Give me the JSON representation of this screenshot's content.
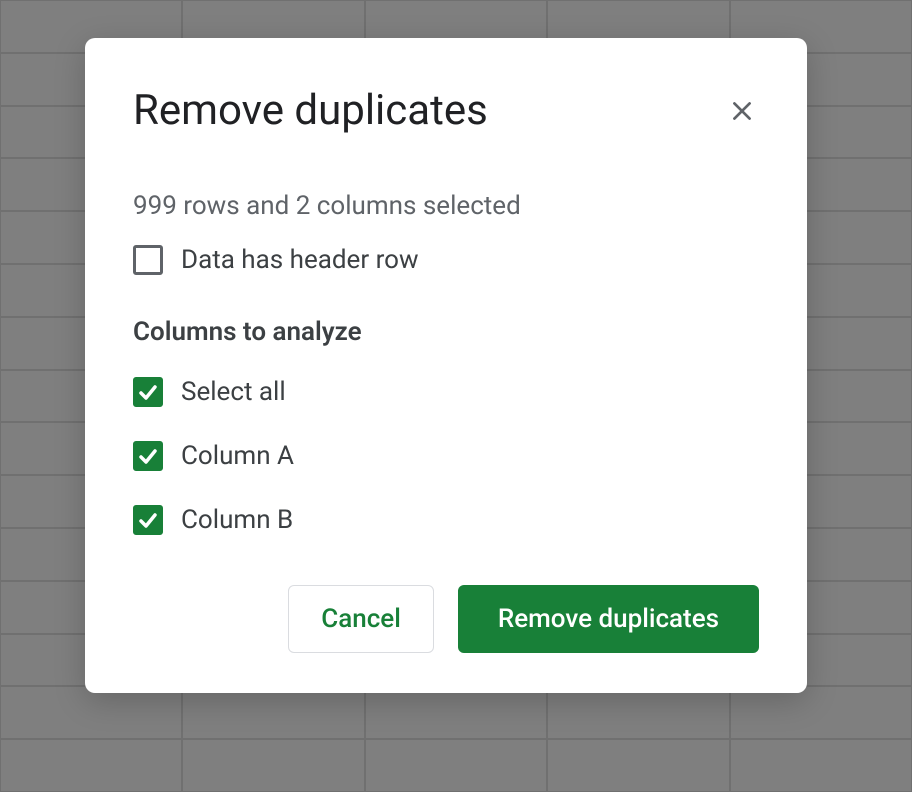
{
  "dialog": {
    "title": "Remove duplicates",
    "selection_info": "999 rows and 2 columns selected",
    "header_row_label": "Data has header row",
    "header_row_checked": false,
    "columns_heading": "Columns to analyze",
    "select_all_label": "Select all",
    "select_all_checked": true,
    "columns": [
      {
        "label": "Column A",
        "checked": true
      },
      {
        "label": "Column B",
        "checked": true
      }
    ],
    "cancel_label": "Cancel",
    "confirm_label": "Remove duplicates"
  }
}
